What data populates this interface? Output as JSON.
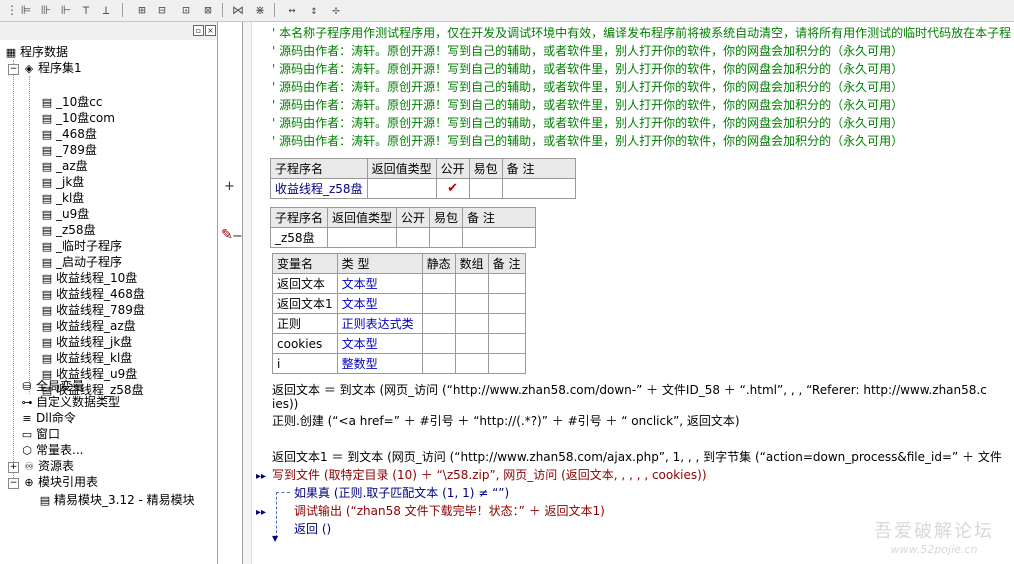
{
  "toolbar": {
    "icons": [
      "align-left-icon",
      "align-center-v-icon",
      "align-right-icon",
      "align-bottom-icon",
      "align-top-icon",
      "align-h-center-icon",
      "center-h-icon",
      "center-v-icon",
      "distribute-h-icon",
      "distribute-v-icon",
      "same-width-icon",
      "same-height-icon",
      "same-size-icon"
    ]
  },
  "tree": {
    "root": "程序数据",
    "program_set": "程序集1",
    "subs": [
      "_10盘cc",
      "_10盘com",
      "_468盘",
      "_789盘",
      "_az盘",
      "_jk盘",
      "_kl盘",
      "_u9盘",
      "_z58盘",
      "_临时子程序",
      "_启动子程序",
      "收益线程_10盘",
      "收益线程_468盘",
      "收益线程_789盘",
      "收益线程_az盘",
      "收益线程_jk盘",
      "收益线程_kl盘",
      "收益线程_u9盘",
      "收益线程_z58盘"
    ],
    "globals": "全局变量",
    "custom_types": "自定义数据类型",
    "dll": "Dll命令",
    "window": "窗口",
    "constants": "常量表...",
    "resources": "资源表",
    "module_refs": "模块引用表",
    "module": "精易模块_3.12 - 精易模块"
  },
  "code": {
    "header_comment": "' 本名称子程序用作测试程序用，仅在开发及调试环境中有效，编译发布程序前将被系统自动清空，请将所有用作测试的临时代码放在本子程",
    "credit_comment": "' 源码由作者：涛轩。原创开源！写到自己的辅助，或者软件里，别人打开你的软件，你的网盘会加积分的（永久可用）",
    "credit_count": 6,
    "table1": {
      "headers": [
        "子程序名",
        "返回值类型",
        "公开",
        "易包",
        "备 注"
      ],
      "row": {
        "name": "收益线程_z58盘",
        "ret": "",
        "public": "✔",
        "pkg": "",
        "note": ""
      }
    },
    "table2": {
      "headers": [
        "子程序名",
        "返回值类型",
        "公开",
        "易包",
        "备 注"
      ],
      "row": {
        "name": "_z58盘",
        "ret": "",
        "public": "",
        "pkg": "",
        "note": ""
      }
    },
    "vars": {
      "headers": [
        "变量名",
        "类 型",
        "静态",
        "数组",
        "备 注"
      ],
      "rows": [
        {
          "name": "返回文本",
          "type": "文本型"
        },
        {
          "name": "返回文本1",
          "type": "文本型"
        },
        {
          "name": "正则",
          "type": "正则表达式类"
        },
        {
          "name": "cookies",
          "type": "文本型"
        },
        {
          "name": "i",
          "type": "整数型"
        }
      ]
    },
    "line1a": "返回文本 ＝ 到文本 (网页_访问 (“http://www.zhan58.com/down-” ＋ 文件ID_58 ＋ “.html”, , , “Referer: http://www.zhan58.c",
    "line1b": "ies))",
    "line2": "正则.创建 (“<a href=” ＋ #引号 ＋ “http://(.*?)” ＋ #引号 ＋ “ onclick”, 返回文本)",
    "line3": "返回文本1 ＝ 到文本 (网页_访问 (“http://www.zhan58.com/ajax.php”, 1, , , 到字节集 (“action=down_process&file_id=” ＋ 文件",
    "line4": "写到文件 (取特定目录 (10) ＋ “\\z58.zip”, 网页_访问 (返回文本, , , , , cookies))",
    "line5": "如果真 (正则.取子匹配文本 (1, 1) ≠ “”)",
    "line6": "调试输出 (“zhan58 文件下载完毕！状态：” ＋ 返回文本1)",
    "line7": "返回 ()"
  },
  "watermark": {
    "title": "吾爱破解论坛",
    "url": "www.52pojie.cn"
  }
}
